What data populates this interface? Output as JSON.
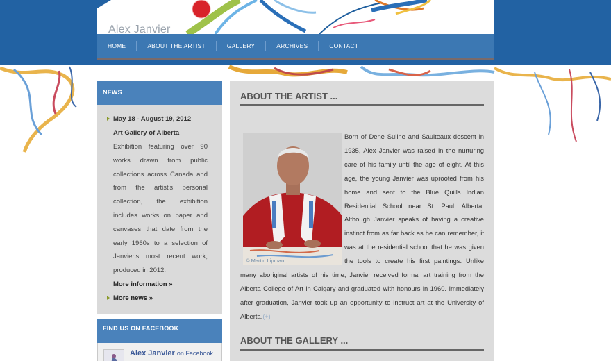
{
  "site": {
    "title": "Alex Janvier"
  },
  "nav": {
    "items": [
      "HOME",
      "ABOUT THE ARTIST",
      "GALLERY",
      "ARCHIVES",
      "CONTACT"
    ]
  },
  "news": {
    "heading": "NEWS",
    "item": {
      "date": "May 18 - August 19, 2012",
      "venue": "Art Gallery of Alberta",
      "description": "Exhibition featuring over 90 works drawn from public collections across Canada and from the artist's personal collection, the exhibition includes works on paper and canvases that date from the early 1960s to a selection of Janvier's most recent work, produced in 2012.",
      "more": "More information »"
    },
    "more_news": "More news »"
  },
  "facebook": {
    "heading": "FIND US ON FACEBOOK",
    "name": "Alex Janvier",
    "suffix": "on Facebook"
  },
  "main": {
    "about_title": "ABOUT THE ARTIST ...",
    "photo_credit": "© Martin Lipman",
    "article": "Born of Dene Suline and Saulteaux descent in 1935, Alex Janvier was raised in the nurturing care of his family until the age of eight. At this age, the young Janvier was uprooted from his home and sent to the Blue Quills Indian Residential School near St. Paul, Alberta. Although Janvier speaks of having a creative instinct from as far back as he can remember, it was at the residential school that he was given the tools to create his first paintings. Unlike many aboriginal artists of his time, Janvier received formal art training from the Alberta College of Art in Calgary and graduated with honours in 1960. Immediately after graduation, Janvier took up an opportunity to instruct art at the University of Alberta.",
    "read_more": "(+)",
    "gallery_title": "ABOUT THE GALLERY ..."
  }
}
